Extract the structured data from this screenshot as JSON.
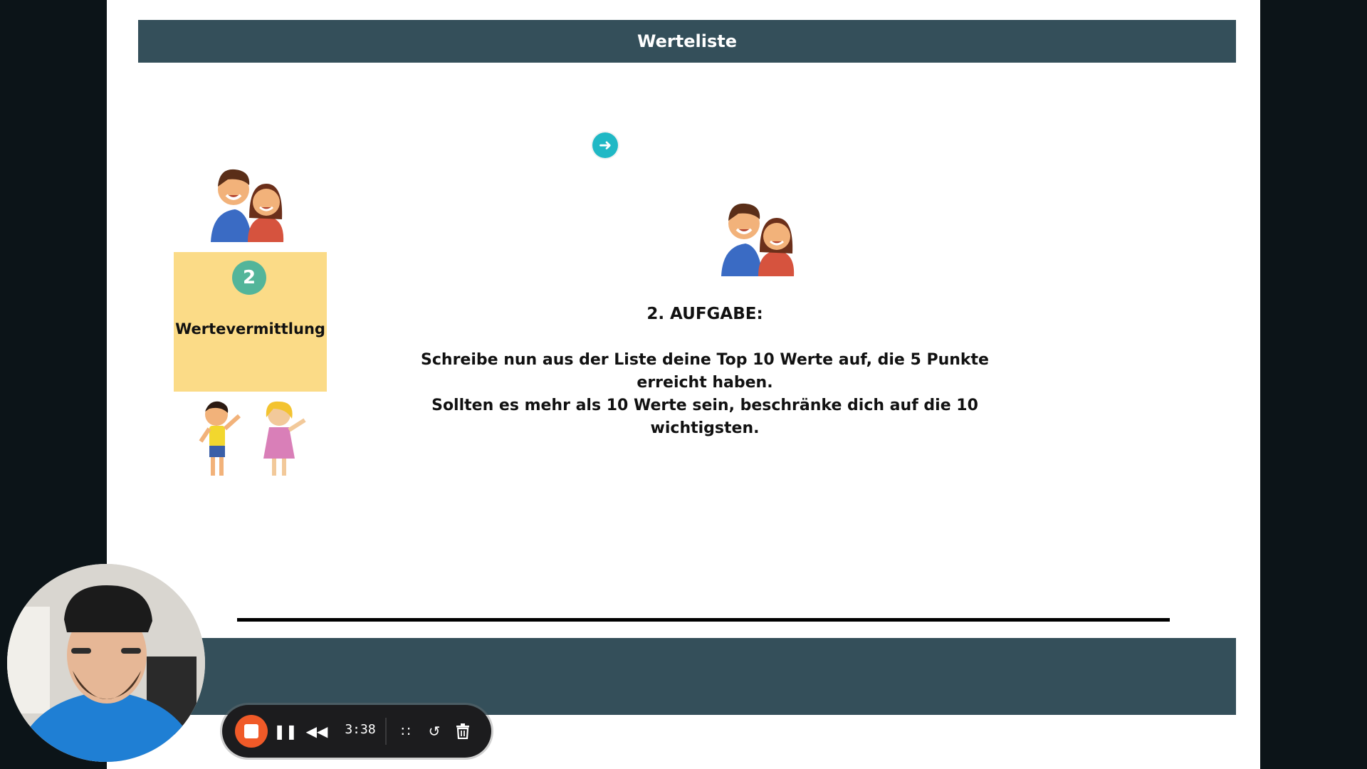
{
  "slide": {
    "header_title": "Werteliste",
    "step_number": "2",
    "step_label": "Wertevermittlung",
    "task_title": "2. AUFGABE:",
    "task_line_1": "Schreibe nun aus der Liste deine Top 10 Werte auf, die 5 Punkte erreicht haben.",
    "task_line_2": "Sollten es mehr als 10 Werte sein, beschränke dich auf die 10 wichtigsten."
  },
  "recorder": {
    "elapsed_time": "3:38"
  },
  "icons": {
    "cursor": "arrow-right-circle-icon",
    "stop": "stop-icon",
    "pause": "pause-icon",
    "rewind": "rewind-icon",
    "grid": "dot-grid-icon",
    "restart": "restart-icon",
    "delete": "trash-icon"
  },
  "colors": {
    "header_bar": "#344f5a",
    "sticky_note": "#fbdb87",
    "step_circle": "#53b59a",
    "cursor": "#20b8c5",
    "record_stop": "#f05a28"
  }
}
